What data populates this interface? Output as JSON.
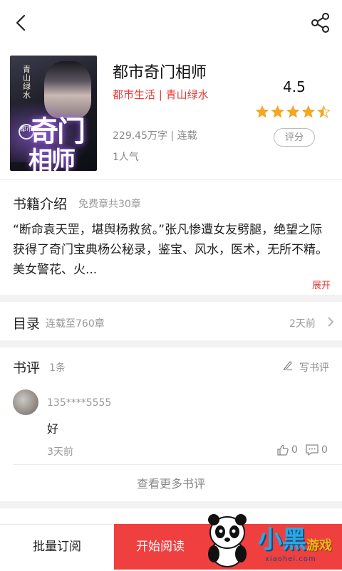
{
  "book": {
    "title": "都市奇门相师",
    "genre_author": "都市生活 | 青山绿水",
    "rating": "4.5",
    "stars_value": 4.5,
    "stars_max": 5,
    "rate_button": "评分",
    "words_status": "229.45万字 | 连载",
    "popularity": "1人气",
    "cover": {
      "publisher": "青山绿水",
      "title_line1": "奇门",
      "title_line2": "相师",
      "tag": "都市"
    }
  },
  "intro": {
    "heading": "书籍介绍",
    "free_chapters": "免费章共30章",
    "text": "“断命袁天罡，堪舆杨救贫。”张凡惨遭女友劈腿，绝望之际获得了奇门宝典杨公秘录，鉴宝、风水，医术，无所不精。美女警花、火...",
    "expand_label": "展开"
  },
  "toc": {
    "heading": "目录",
    "status": "连载至760章",
    "updated": "2天前"
  },
  "reviews": {
    "heading": "书评",
    "count": "1条",
    "write_label": "写书评",
    "items": [
      {
        "user": "135****5555",
        "text": "好",
        "time": "3天前",
        "likes": "0",
        "comments": "0"
      }
    ],
    "more_label": "查看更多书评"
  },
  "actions": {
    "bulk_subscribe": "批量订阅",
    "start_reading": "开始阅读"
  },
  "watermark": {
    "text1": "小黑",
    "text2": "游戏",
    "url": "xiaohei.com"
  },
  "colors": {
    "accent": "#e53935",
    "button_red": "#ef3f3f",
    "star": "#f5a623"
  }
}
